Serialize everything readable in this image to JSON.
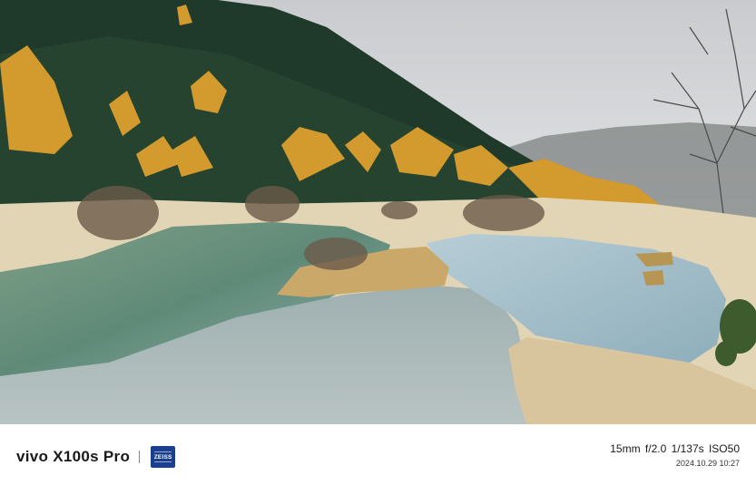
{
  "photo": {
    "subject": "mountain-valley-with-travertine-pools",
    "colors": {
      "sky": "#d7d9dc",
      "forest": "#1f3a2a",
      "larch": "#d39a2e",
      "water_teal": "#6f9a8c",
      "water_blue": "#a9c3cf",
      "travertine": "#e2d5b6"
    }
  },
  "footer": {
    "brand": "vivo X100s Pro",
    "partner_logo": "ZEISS",
    "params": "15mm  f/2.0  1/137s  ISO50",
    "datetime": "2024.10.29 10:27"
  }
}
